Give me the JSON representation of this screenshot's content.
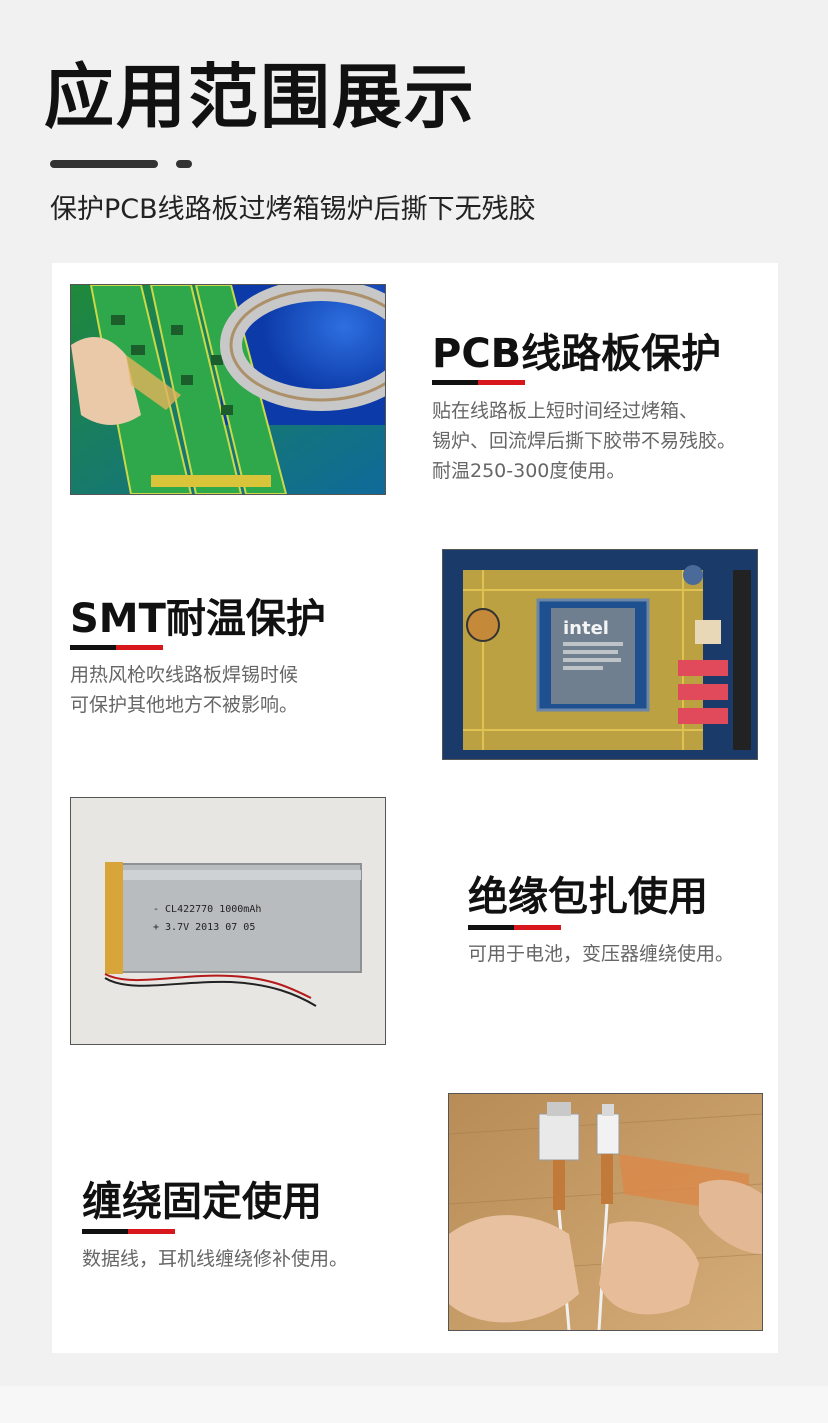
{
  "header": {
    "title": "应用范围展示",
    "subtitle": "保护PCB线路板过烤箱锡炉后撕下无残胶"
  },
  "sections": [
    {
      "title": "PCB线路板保护",
      "lines": [
        "贴在线路板上短时间经过烤箱、",
        "锡炉、回流焊后撕下胶带不易残胶。",
        "耐温250-300度使用。"
      ],
      "image": "pcb-tape-photo"
    },
    {
      "title": "SMT耐温保护",
      "lines": [
        "用热风枪吹线路板焊锡时候",
        "可保护其他地方不被影响。"
      ],
      "image": "motherboard-chip-photo",
      "image_text": {
        "brand": "intel"
      }
    },
    {
      "title": "绝缘包扎使用",
      "lines": [
        "可用于电池，变压器缠绕使用。"
      ],
      "image": "battery-photo",
      "image_text": {
        "line1": "- CL422770 1000mAh",
        "line2": "+ 3.7V 2013 07 05"
      }
    },
    {
      "title": "缠绕固定使用",
      "lines": [
        "数据线，耳机线缠绕修补使用。"
      ],
      "image": "cable-wrap-photo"
    }
  ],
  "colors": {
    "accent": "#d8171d",
    "dark": "#111111",
    "text_gray": "#666666"
  }
}
